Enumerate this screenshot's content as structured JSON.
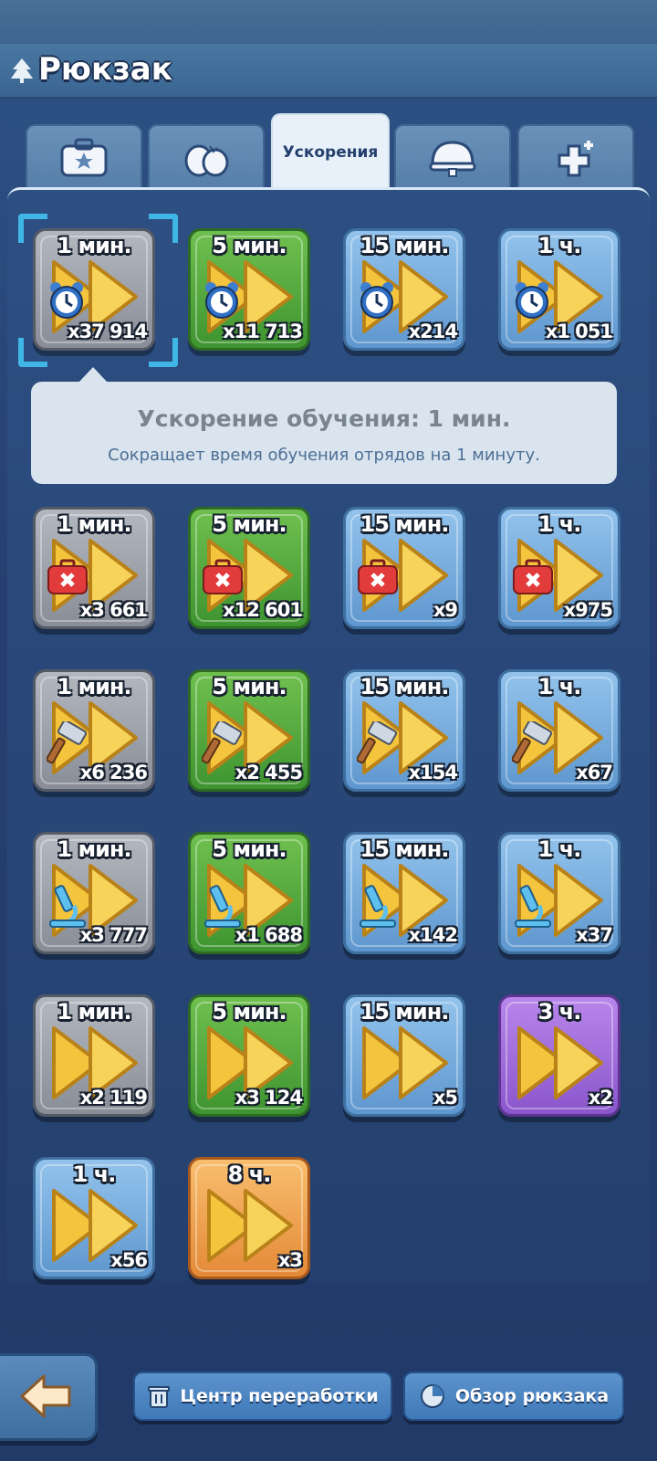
{
  "header": {
    "title": "Рюкзак"
  },
  "tabs": [
    {
      "icon": "briefcase-star-icon",
      "label": ""
    },
    {
      "icon": "eggs-icon",
      "label": ""
    },
    {
      "icon": "",
      "label": "Ускорения"
    },
    {
      "icon": "helmet-icon",
      "label": ""
    },
    {
      "icon": "medical-cross-icon",
      "label": ""
    }
  ],
  "items": [
    {
      "duration": "1 мин.",
      "quantity": "x37 914",
      "type": "training",
      "tier": "gray"
    },
    {
      "duration": "5 мин.",
      "quantity": "x11 713",
      "type": "training",
      "tier": "green"
    },
    {
      "duration": "15 мин.",
      "quantity": "x214",
      "type": "training",
      "tier": "blue"
    },
    {
      "duration": "1 ч.",
      "quantity": "x1 051",
      "type": "training",
      "tier": "blue"
    },
    {
      "duration": "1 мин.",
      "quantity": "x3 661",
      "type": "healing",
      "tier": "gray"
    },
    {
      "duration": "5 мин.",
      "quantity": "x12 601",
      "type": "healing",
      "tier": "green"
    },
    {
      "duration": "15 мин.",
      "quantity": "x9",
      "type": "healing",
      "tier": "blue"
    },
    {
      "duration": "1 ч.",
      "quantity": "x975",
      "type": "healing",
      "tier": "blue"
    },
    {
      "duration": "1 мин.",
      "quantity": "x6 236",
      "type": "building",
      "tier": "gray"
    },
    {
      "duration": "5 мин.",
      "quantity": "x2 455",
      "type": "building",
      "tier": "green"
    },
    {
      "duration": "15 мин.",
      "quantity": "x154",
      "type": "building",
      "tier": "blue"
    },
    {
      "duration": "1 ч.",
      "quantity": "x67",
      "type": "building",
      "tier": "blue"
    },
    {
      "duration": "1 мин.",
      "quantity": "x3 777",
      "type": "research",
      "tier": "gray"
    },
    {
      "duration": "5 мин.",
      "quantity": "x1 688",
      "type": "research",
      "tier": "green"
    },
    {
      "duration": "15 мин.",
      "quantity": "x142",
      "type": "research",
      "tier": "blue"
    },
    {
      "duration": "1 ч.",
      "quantity": "x37",
      "type": "research",
      "tier": "blue"
    },
    {
      "duration": "1 мин.",
      "quantity": "x2 119",
      "type": "universal",
      "tier": "gray"
    },
    {
      "duration": "5 мин.",
      "quantity": "x3 124",
      "type": "universal",
      "tier": "green"
    },
    {
      "duration": "15 мин.",
      "quantity": "x5",
      "type": "universal",
      "tier": "blue"
    },
    {
      "duration": "3 ч.",
      "quantity": "x2",
      "type": "universal",
      "tier": "purple"
    },
    {
      "duration": "1 ч.",
      "quantity": "x56",
      "type": "universal",
      "tier": "blue"
    },
    {
      "duration": "8 ч.",
      "quantity": "x3",
      "type": "universal",
      "tier": "orange"
    }
  ],
  "tooltip": {
    "title": "Ускорение обучения: 1 мин.",
    "description": "Сокращает время обучения отрядов на 1 минуту."
  },
  "footer": {
    "back_icon": "back-arrow-icon",
    "recycle_label": "Центр переработки",
    "recycle_icon": "trash-can-icon",
    "overview_label": "Обзор рюкзака",
    "overview_icon": "pie-chart-icon"
  },
  "colors": {
    "accent_selection": "#3fb6e6",
    "arrow_yellow": "#f5c43d",
    "tier_gray": "#9ea3ac",
    "tier_green": "#55a83d",
    "tier_blue": "#7aaee0",
    "tier_purple": "#a06fdc",
    "tier_orange": "#f0a452"
  }
}
